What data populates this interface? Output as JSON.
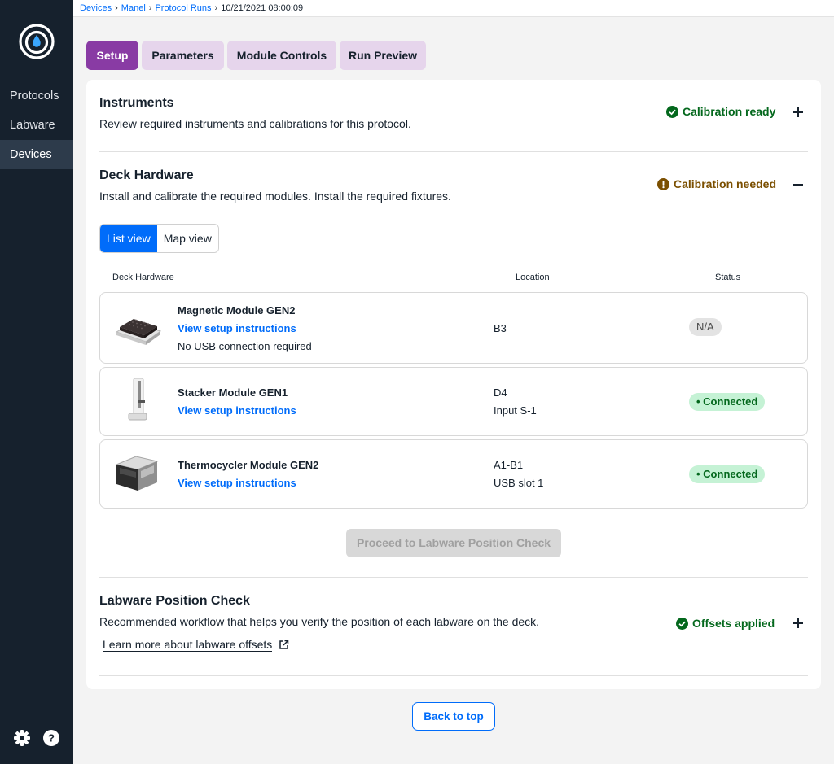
{
  "breadcrumb": {
    "items": [
      "Devices",
      "Manel",
      "Protocol Runs"
    ],
    "current": "10/21/2021 08:00:09"
  },
  "sidebar": {
    "items": [
      {
        "label": "Protocols"
      },
      {
        "label": "Labware"
      },
      {
        "label": "Devices"
      }
    ]
  },
  "tabs": [
    {
      "label": "Setup"
    },
    {
      "label": "Parameters"
    },
    {
      "label": "Module Controls"
    },
    {
      "label": "Run Preview"
    }
  ],
  "instruments": {
    "title": "Instruments",
    "description": "Review required instruments and calibrations for this protocol.",
    "status": "Calibration ready"
  },
  "deck": {
    "title": "Deck Hardware",
    "description": "Install and calibrate the required modules. Install the required fixtures.",
    "status": "Calibration needed",
    "view_list": "List view",
    "view_map": "Map view",
    "columns": [
      "Deck Hardware",
      "Location",
      "Status"
    ],
    "rows": [
      {
        "name": "Magnetic Module GEN2",
        "link": "View setup instructions",
        "note": "No USB connection required",
        "location": "B3",
        "location_sub": "",
        "status": "N/A"
      },
      {
        "name": "Stacker Module GEN1",
        "link": "View setup instructions",
        "note": "",
        "location": "D4",
        "location_sub": "Input S-1",
        "status": "Connected"
      },
      {
        "name": "Thermocycler Module GEN2",
        "link": "View setup instructions",
        "note": "",
        "location": "A1-B1",
        "location_sub": "USB slot 1",
        "status": "Connected"
      }
    ],
    "proceed_label": "Proceed to Labware Position Check"
  },
  "lpc": {
    "title": "Labware Position Check",
    "description": "Recommended workflow that helps you verify the position of each labware on the deck.",
    "learn_more": "Learn more about labware offsets",
    "status": "Offsets applied"
  },
  "back_to_top": "Back to top",
  "colors": {
    "accent": "#893ba4",
    "tab_inactive": "#e6d5ec",
    "link": "#006cfa",
    "success": "#04681d",
    "warning": "#9c6b00",
    "sidebar_bg": "#16212d"
  },
  "icons": {
    "logo": "opentrons-logo-icon",
    "settings": "gear-icon",
    "help": "help-icon",
    "check": "check-circle-icon",
    "alert": "alert-circle-icon",
    "expand": "plus-icon",
    "collapse": "minus-icon",
    "external": "external-link-icon"
  }
}
